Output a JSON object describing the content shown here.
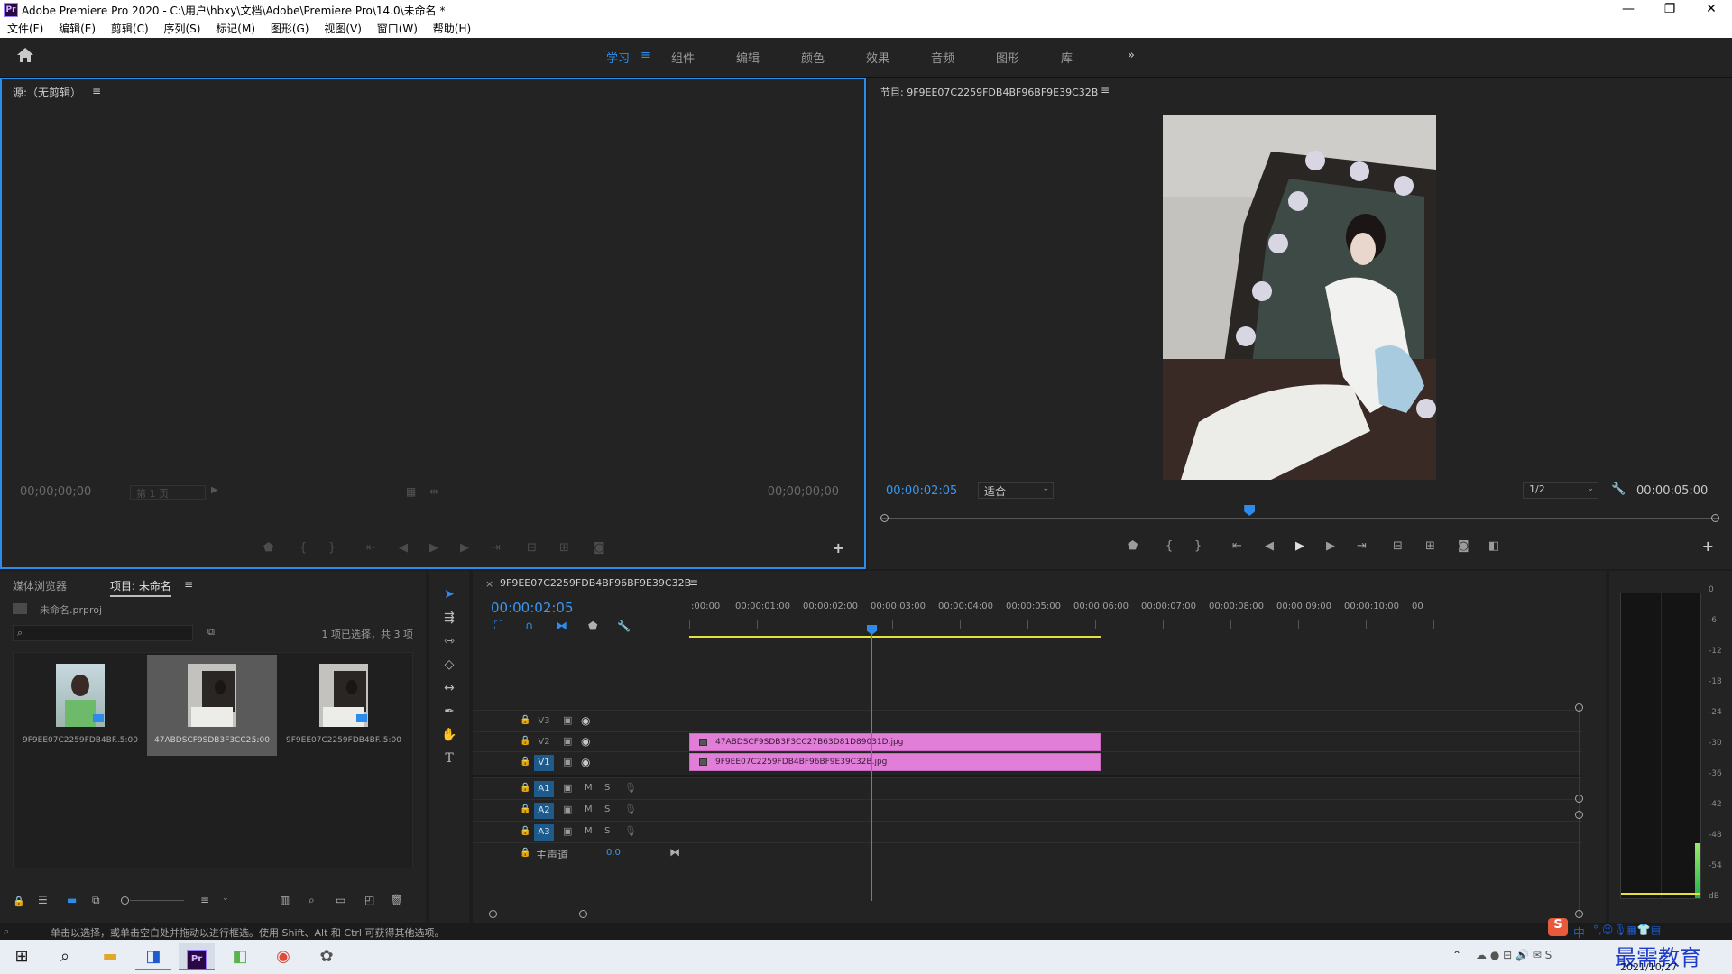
{
  "titlebar": {
    "logo": "Pr",
    "title": "Adobe Premiere Pro 2020 - C:\\用户\\hbxy\\文档\\Adobe\\Premiere Pro\\14.0\\未命名 *",
    "minimize": "—",
    "restore": "❐",
    "close": "✕"
  },
  "menu": [
    "文件(F)",
    "编辑(E)",
    "剪辑(C)",
    "序列(S)",
    "标记(M)",
    "图形(G)",
    "视图(V)",
    "窗口(W)",
    "帮助(H)"
  ],
  "workspaces": {
    "items": [
      "学习",
      "组件",
      "编辑",
      "颜色",
      "效果",
      "音频",
      "图形",
      "库"
    ],
    "active": "学习",
    "more": "»",
    "menu_icon": "≡"
  },
  "source": {
    "title": "源:（无剪辑）",
    "tc_left": "00;00;00;00",
    "page": "第 1 页",
    "tc_right": "00;00;00;00"
  },
  "program": {
    "title": "节目: 9F9EE07C2259FDB4BF96BF9E39C32B",
    "tc": "00:00:02:05",
    "fit": "适合",
    "resolution": "1/2",
    "duration": "00:00:05:00",
    "playhead_fraction": 0.44
  },
  "project": {
    "tab_media": "媒体浏览器",
    "tab_project": "项目: 未命名",
    "proj_file": "未命名.prproj",
    "selection": "1 项已选择，共 3 项",
    "items": [
      {
        "name": "9F9EE07C2259FDB4BF...",
        "dur": "5:00"
      },
      {
        "name": "47ABDSCF9SDB3F3CC2...",
        "dur": "5:00"
      },
      {
        "name": "9F9EE07C2259FDB4BF...",
        "dur": "5:00"
      }
    ]
  },
  "timeline": {
    "tab": "9F9EE07C2259FDB4BF96BF9E39C32B",
    "tc": "00:00:02:05",
    "ruler": [
      ":00:00",
      "00:00:01:00",
      "00:00:02:00",
      "00:00:03:00",
      "00:00:04:00",
      "00:00:05:00",
      "00:00:06:00",
      "00:00:07:00",
      "00:00:08:00",
      "00:00:09:00",
      "00:00:10:00",
      "00"
    ],
    "video_tracks": [
      "V3",
      "V2",
      "V1"
    ],
    "audio_tracks": [
      "A1",
      "A2",
      "A3"
    ],
    "master_label": "主声道",
    "master_value": "0.0",
    "clip_v2": "47ABDSCF9SDB3F3CC27B63D81D89031D.jpg",
    "clip_v1": "9F9EE07C2259FDB4BF96BF9E39C32B.jpg",
    "m_label": "M",
    "s_label": "S"
  },
  "meter": {
    "labels": [
      "0",
      "-6",
      "-12",
      "-18",
      "-24",
      "-30",
      "-36",
      "-42",
      "-48",
      "-54",
      "dB"
    ],
    "level_fraction": 0.18
  },
  "status": {
    "text": "单击以选择，或单击空白处并拖动以进行框选。使用 Shift、Alt 和 Ctrl 可获得其他选项。"
  },
  "taskbar": {
    "date": "2021/10/27",
    "watermark": "最需教育",
    "ime": "中",
    "pr_label": "Pr"
  },
  "colors": {
    "accent": "#2d8ceb",
    "clip": "#e07ed8",
    "panel": "#232323",
    "bg": "#1d1d1d"
  }
}
